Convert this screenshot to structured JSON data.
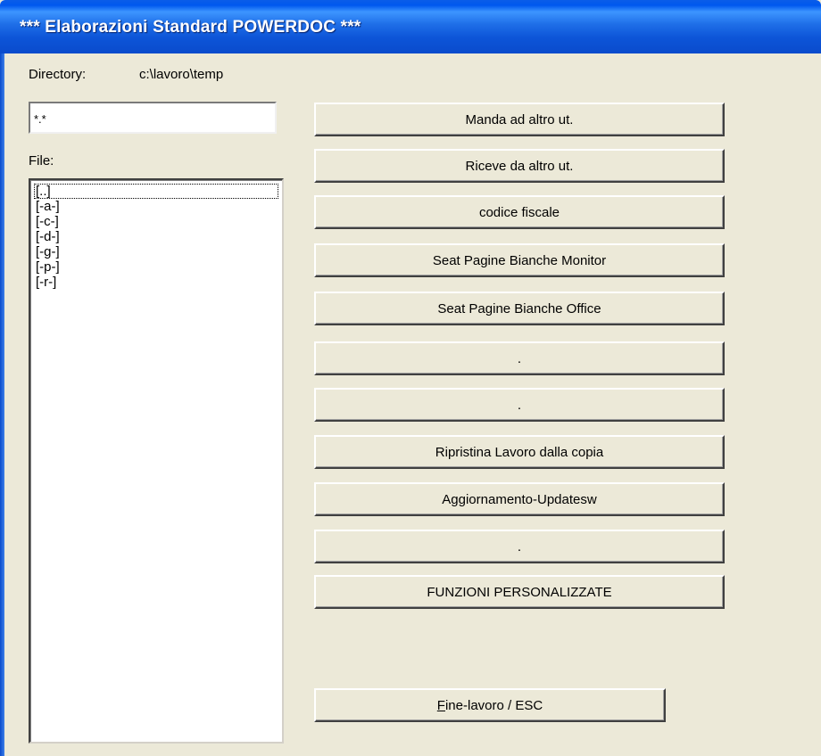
{
  "window": {
    "title": "*** Elaborazioni Standard POWERDOC ***"
  },
  "directory": {
    "label": "Directory:",
    "path": "c:\\lavoro\\temp"
  },
  "filter": {
    "value": "*.*"
  },
  "files": {
    "label": "File:",
    "items": [
      "[..]",
      "[-a-]",
      "[-c-]",
      "[-d-]",
      "[-g-]",
      "[-p-]",
      "[-r-]"
    ]
  },
  "buttons": [
    "Manda ad altro ut.",
    "Riceve da altro ut.",
    "codice fiscale",
    "Seat Pagine Bianche Monitor",
    "Seat Pagine Bianche Office",
    ".",
    ".",
    "Ripristina Lavoro dalla copia",
    "Aggiornamento-Updatesw",
    ".",
    "FUNZIONI PERSONALIZZATE"
  ],
  "exit_button": {
    "mnemonic": "F",
    "label_rest": "ine-lavoro / ESC"
  }
}
